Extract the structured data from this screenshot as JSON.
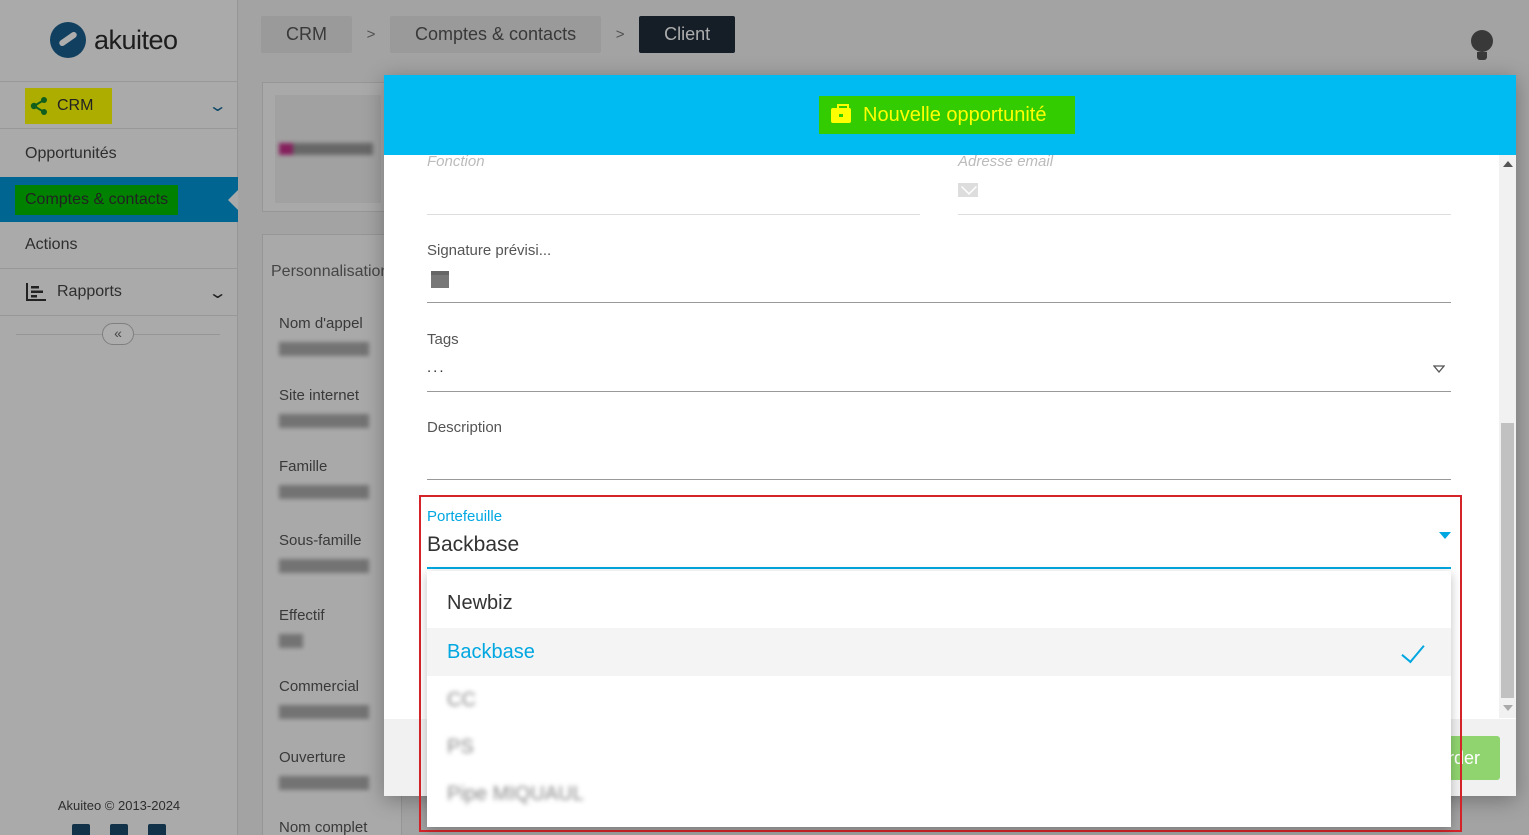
{
  "sidebar": {
    "logo_text": "akuiteo",
    "crm_label": "CRM",
    "items": [
      {
        "label": "Opportunités"
      },
      {
        "label": "Comptes & contacts"
      },
      {
        "label": "Actions"
      }
    ],
    "rapports_label": "Rapports",
    "copyright": "Akuiteo © 2013-2024"
  },
  "breadcrumb": {
    "items": [
      "CRM",
      "Comptes & contacts",
      "Client"
    ],
    "separator": ">"
  },
  "background": {
    "section_title": "Personnalisation",
    "fields": [
      {
        "label": "Nom d'appel"
      },
      {
        "label": "Site internet"
      },
      {
        "label": "Famille"
      },
      {
        "label": "Sous-famille"
      },
      {
        "label": "Effectif"
      },
      {
        "label": "Commercial"
      },
      {
        "label": "Ouverture"
      },
      {
        "label": "Nom complet"
      }
    ]
  },
  "modal": {
    "title": "Nouvelle opportunité",
    "fields": {
      "fonction_label": "Fonction",
      "email_label": "Adresse email",
      "signature_label": "Signature prévisi...",
      "tags_label": "Tags",
      "tags_value": "...",
      "description_label": "Description",
      "portefeuille_label": "Portefeuille",
      "portefeuille_value": "Backbase"
    },
    "dropdown_options": [
      "Newbiz",
      "Backbase",
      "CC",
      "PS",
      "Pipe MIQUAUL"
    ],
    "selected_option": "Backbase",
    "save_button_label": "rder"
  },
  "colors": {
    "header_blue": "#00baf2",
    "accent_blue": "#00a7e1",
    "title_highlight": "#33cc00",
    "title_text": "#ffff00",
    "crm_highlight": "#ffff00",
    "active_nav_bg": "#0095d4",
    "active_nav_highlight": "#00c000",
    "breadcrumb_active": "#1f2d3a",
    "annotation_red": "#d4242a"
  }
}
